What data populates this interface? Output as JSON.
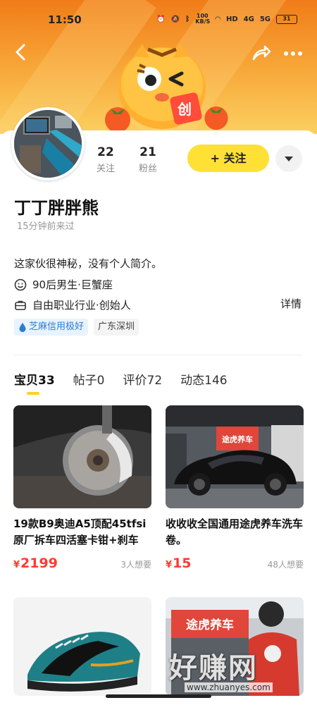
{
  "status_bar": {
    "time": "11:50",
    "network_speed": "100 KB/S",
    "signal_a": "4G",
    "signal_b": "5G",
    "battery": "31"
  },
  "header": {
    "back_icon": "chevron-left-icon",
    "share_icon": "share-icon",
    "more_icon": "more-dots-icon",
    "mascot_badge": "创"
  },
  "profile": {
    "following_count": "22",
    "following_label": "关注",
    "followers_count": "21",
    "followers_label": "粉丝",
    "follow_button": "+ 关注",
    "username": "丁丁胖胖熊",
    "last_seen": "15分钟前来过",
    "bio": "这家伙很神秘，没有个人简介。",
    "age_zodiac": "90后男生·巨蟹座",
    "occupation": "自由职业行业·创始人",
    "details_link": "详情",
    "credit_tag": "芝麻信用极好",
    "location_tag": "广东深圳"
  },
  "tabs": [
    {
      "label": "宝贝",
      "count": "33",
      "active": true
    },
    {
      "label": "帖子",
      "count": "0",
      "active": false
    },
    {
      "label": "评价",
      "count": "72",
      "active": false
    },
    {
      "label": "动态",
      "count": "146",
      "active": false
    }
  ],
  "products": [
    {
      "title": "19款B9奥迪A5顶配45tfsi原厂拆车四活塞卡钳+刹车",
      "currency": "¥",
      "price": "2199",
      "wants": "3人想要"
    },
    {
      "title": "收收收全国通用途虎养车洗车卷。",
      "currency": "¥",
      "price": "15",
      "wants": "48人想要"
    },
    {
      "title": "",
      "currency": "",
      "price": "",
      "wants": ""
    },
    {
      "title": "",
      "currency": "",
      "price": "",
      "wants": ""
    }
  ],
  "product_image_text": {
    "tuhu_sign": "途虎养车",
    "tuhu_sign_2": "途虎养车"
  },
  "watermark": {
    "text": "好赚网",
    "url": "www.zhuanyes.com"
  },
  "colors": {
    "banner_top": "#f07c18",
    "banner_bottom": "#fbd060",
    "follow_button": "#ffe034",
    "price": "#ff3b30",
    "tab_indicator": "#ffd21f",
    "credit_tag_bg": "#e8f3ff",
    "credit_tag_text": "#2b7cd3"
  }
}
